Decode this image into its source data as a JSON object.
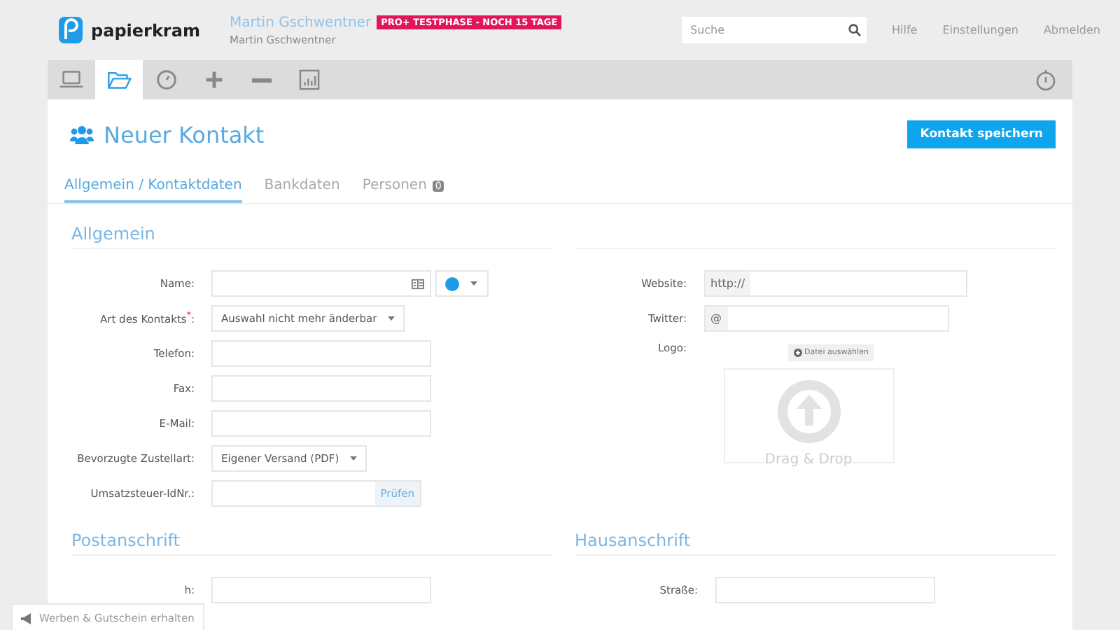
{
  "header": {
    "brand": "papierkram",
    "user_name": "Martin Gschwentner",
    "badge": "PRO+ TESTPHASE - NOCH 15 TAGE",
    "company": "Martin Gschwentner",
    "search": {
      "placeholder": "Suche"
    },
    "links": [
      "Hilfe",
      "Einstellungen",
      "Abmelden"
    ]
  },
  "toolbar": {
    "items": [
      {
        "kind": "laptop",
        "selected": false
      },
      {
        "kind": "folder",
        "selected": true
      },
      {
        "kind": "clock",
        "selected": false
      },
      {
        "kind": "plus",
        "selected": false
      },
      {
        "kind": "minus",
        "selected": false
      },
      {
        "kind": "chart",
        "selected": false
      }
    ]
  },
  "page": {
    "title": "Neuer Kontakt",
    "save_button": "Kontakt speichern"
  },
  "tabs": [
    {
      "label": "Allgemein / Kontaktdaten",
      "selected": true
    },
    {
      "label": "Bankdaten",
      "selected": false
    },
    {
      "label": "Personen",
      "count": "0",
      "selected": false
    }
  ],
  "general": {
    "title": "Allgemein",
    "left_fields": [
      {
        "label": "Name:",
        "kind": "name",
        "color": "#1e9be9"
      },
      {
        "label": "Art des Kontakts$^{*}$:",
        "kind": "select",
        "value": "Auswahl nicht mehr änderbar"
      },
      {
        "label": "Telefon:",
        "kind": "text"
      },
      {
        "label": "Fax:",
        "kind": "text"
      },
      {
        "label": "E-Mail:",
        "kind": "text"
      },
      {
        "label": "Bevorzugte Zustellart:",
        "kind": "select",
        "value": "Eigener Versand (PDF)"
      },
      {
        "label": "Umsatzsteuer-IdNr.:",
        "kind": "check",
        "button": "Prüfen"
      }
    ],
    "right_fields": [
      {
        "label": "Website:",
        "kind": "prefix",
        "prefix": "http://"
      },
      {
        "label": "Twitter:",
        "kind": "prefix",
        "prefix": "@"
      },
      {
        "label": "Logo:",
        "kind": "upload",
        "button": "Datei auswählen",
        "drop_text": "Drag & Drop"
      }
    ]
  },
  "postal": {
    "title": "Postanschrift",
    "fields": [
      {
        "label": "h:"
      }
    ]
  },
  "house": {
    "title": "Hausanschrift",
    "fields": [
      {
        "label": "Straße:"
      }
    ]
  },
  "promo": {
    "label": "Werben & Gutschein erhalten"
  }
}
